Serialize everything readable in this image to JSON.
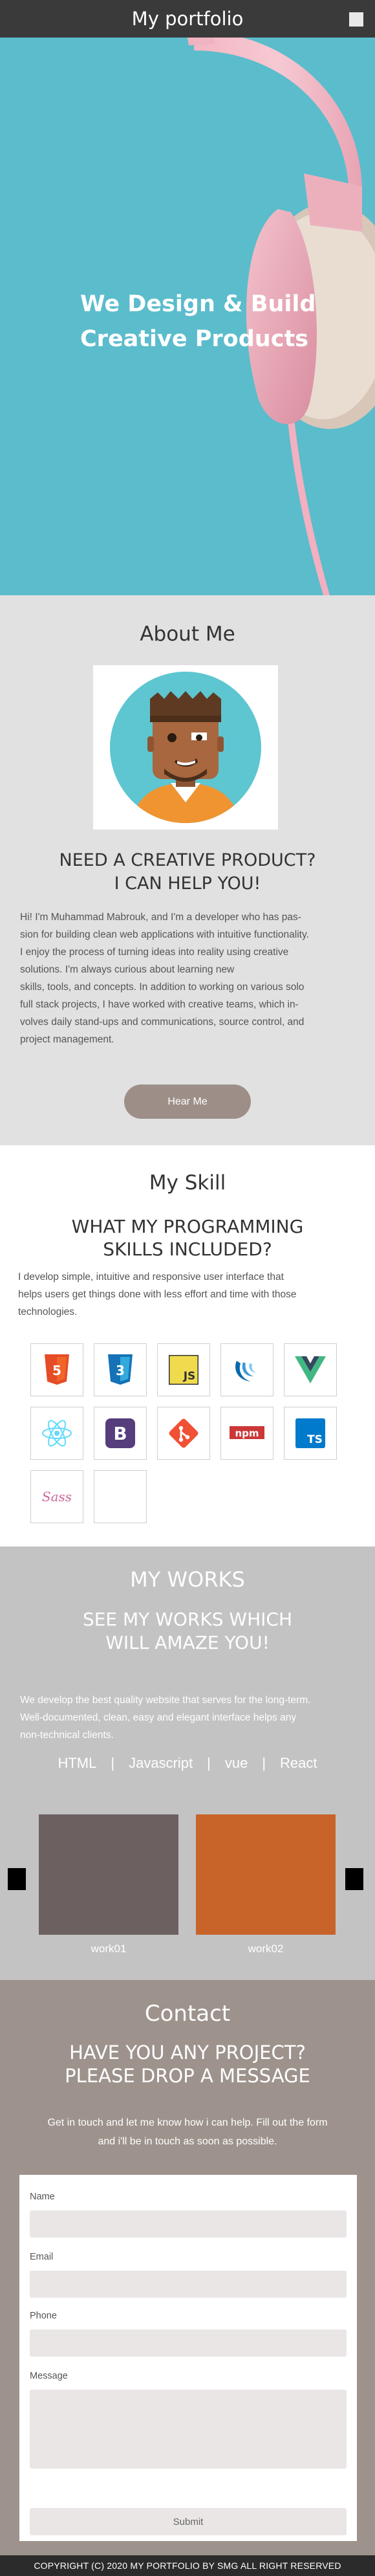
{
  "header": {
    "title": "My portfolio"
  },
  "hero": {
    "line1": "We Design & Build",
    "line2": "Creative Products"
  },
  "about": {
    "title": "About Me",
    "sub1": "NEED A CREATIVE PRODUCT?",
    "sub2": "I CAN HELP YOU!",
    "bio": "Hi! I'm Muhammad Mabrouk, and I'm a developer who has pas-\nsion for building clean web applications with intuitive functionality.\nI enjoy the process of turning ideas into reality using creative\nsolutions. I'm always curious about learning new\n skills, tools, and concepts. In addition to working on various solo\nfull stack projects, I have worked with creative teams, which in-\nvolves daily stand-ups and communications, source control, and\nproject management.",
    "button": "Hear Me"
  },
  "skills": {
    "title": "My Skill",
    "sub1": "WHAT MY PROGRAMMING",
    "sub2": "SKILLS INCLUDED?",
    "desc": "I develop simple, intuitive and responsive user interface that\nhelps users get things done with less effort and time with those\ntechnologies.",
    "icons": [
      "html5-icon",
      "css3-icon",
      "javascript-icon",
      "jquery-icon",
      "vue-icon",
      "react-icon",
      "bootstrap-icon",
      "git-icon",
      "npm-icon",
      "typescript-icon",
      "sass-icon",
      "blank-tile"
    ],
    "labels": {
      "js": "JS",
      "bootstrap": "B",
      "npm": "npm",
      "ts": "TS",
      "sass": "Sass",
      "html": "5",
      "css": "3"
    }
  },
  "works": {
    "title": "MY WORKS",
    "sub1": "SEE MY WORKS WHICH",
    "sub2": "WILL AMAZE YOU!",
    "desc": "We develop the best quality website that serves for the long-term.\nWell-documented, clean, easy and elegant interface helps any\nnon-technical clients.",
    "filters": [
      "HTML",
      "Javascript",
      "vue",
      "React"
    ],
    "separator": "|",
    "items": [
      {
        "label": "work01",
        "color": "#6d6060"
      },
      {
        "label": "work02",
        "color": "#c8642a"
      }
    ]
  },
  "contact": {
    "title": "Contact",
    "sub1": "HAVE YOU ANY PROJECT?",
    "sub2": "PLEASE DROP A MESSAGE",
    "desc": "Get in touch and let me know how i can help. Fill out the form\nand i'll be in touch as soon as possible.",
    "form": {
      "name_label": "Name",
      "email_label": "Email",
      "phone_label": "Phone",
      "message_label": "Message",
      "submit": "Submit"
    }
  },
  "footer": {
    "text": "COPYRIGHT (C) 2020 MY PORTFOLIO BY SMG ALL RIGHT RESERVED"
  },
  "colors": {
    "hero_bg": "#5bbccc",
    "about_bg": "#e1e1e1",
    "works_bg": "#c3c3c3",
    "contact_bg": "#9d938c",
    "accent_button": "#9d8f88"
  }
}
